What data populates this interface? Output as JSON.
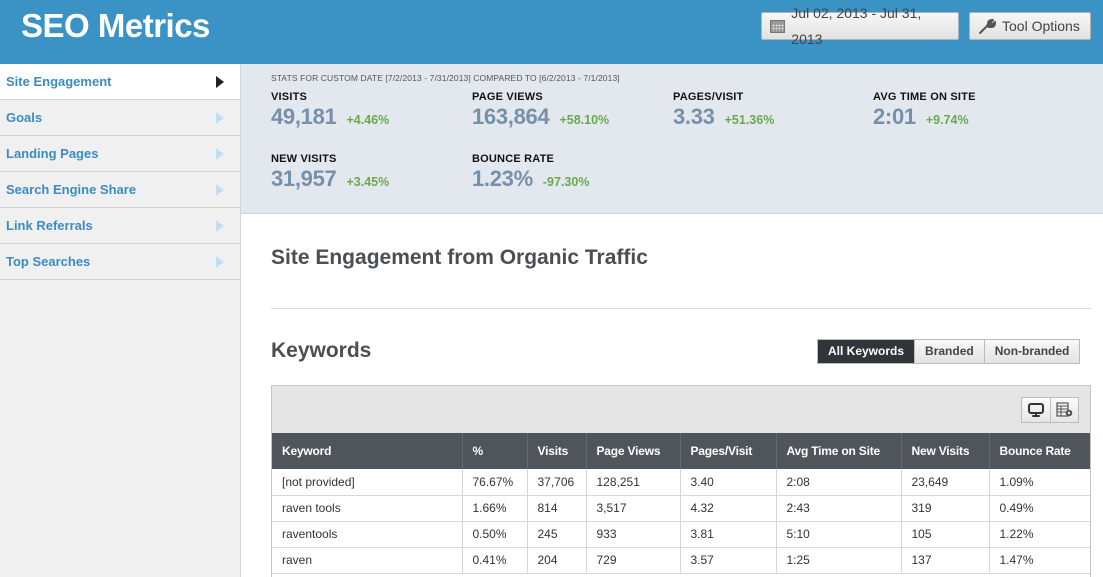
{
  "header": {
    "title": "SEO Metrics",
    "date_range": "Jul 02, 2013 - Jul 31, 2013",
    "tool_options": "Tool Options",
    "icons": {
      "date": "calendar-icon",
      "tools": "wrench-icon"
    }
  },
  "sidebar": {
    "items": [
      {
        "label": "Site Engagement",
        "active": true
      },
      {
        "label": "Goals",
        "active": false
      },
      {
        "label": "Landing Pages",
        "active": false
      },
      {
        "label": "Search Engine Share",
        "active": false
      },
      {
        "label": "Link Referrals",
        "active": false
      },
      {
        "label": "Top Searches",
        "active": false
      }
    ]
  },
  "stats": {
    "caption": "STATS FOR CUSTOM DATE [7/2/2013 - 7/31/2013] COMPARED TO [6/2/2013 - 7/1/2013]",
    "items": [
      {
        "label": "VISITS",
        "value": "49,181",
        "change": "+4.46%"
      },
      {
        "label": "PAGE VIEWS",
        "value": "163,864",
        "change": "+58.10%"
      },
      {
        "label": "PAGES/VISIT",
        "value": "3.33",
        "change": "+51.36%"
      },
      {
        "label": "AVG TIME ON SITE",
        "value": "2:01",
        "change": "+9.74%"
      },
      {
        "label": "NEW VISITS",
        "value": "31,957",
        "change": "+3.45%"
      },
      {
        "label": "BOUNCE RATE",
        "value": "1.23%",
        "change": "-97.30%"
      }
    ],
    "colors": {
      "value": "#7690a9",
      "change_positive": "#6aa84f"
    }
  },
  "content": {
    "section_title": "Site Engagement from Organic Traffic",
    "keywords_title": "Keywords",
    "filters": [
      {
        "label": "All Keywords",
        "active": true
      },
      {
        "label": "Branded",
        "active": false
      },
      {
        "label": "Non-branded",
        "active": false
      }
    ],
    "toolbar_icons": [
      "monitor-icon",
      "table-settings-icon"
    ]
  },
  "table": {
    "columns": [
      "Keyword",
      "%",
      "Visits",
      "Page Views",
      "Pages/Visit",
      "Avg Time on Site",
      "New Visits",
      "Bounce Rate"
    ],
    "rows": [
      [
        "[not provided]",
        "76.67%",
        "37,706",
        "128,251",
        "3.40",
        "2:08",
        "23,649",
        "1.09%"
      ],
      [
        "raven tools",
        "1.66%",
        "814",
        "3,517",
        "4.32",
        "2:43",
        "319",
        "0.49%"
      ],
      [
        "raventools",
        "0.50%",
        "245",
        "933",
        "3.81",
        "5:10",
        "105",
        "1.22%"
      ],
      [
        "raven",
        "0.41%",
        "204",
        "729",
        "3.57",
        "1:25",
        "137",
        "1.47%"
      ]
    ]
  },
  "theme": {
    "header_bg": "#3a93c4",
    "sidebar_link": "#3a8cc0",
    "table_header_bg": "#4f555b"
  }
}
